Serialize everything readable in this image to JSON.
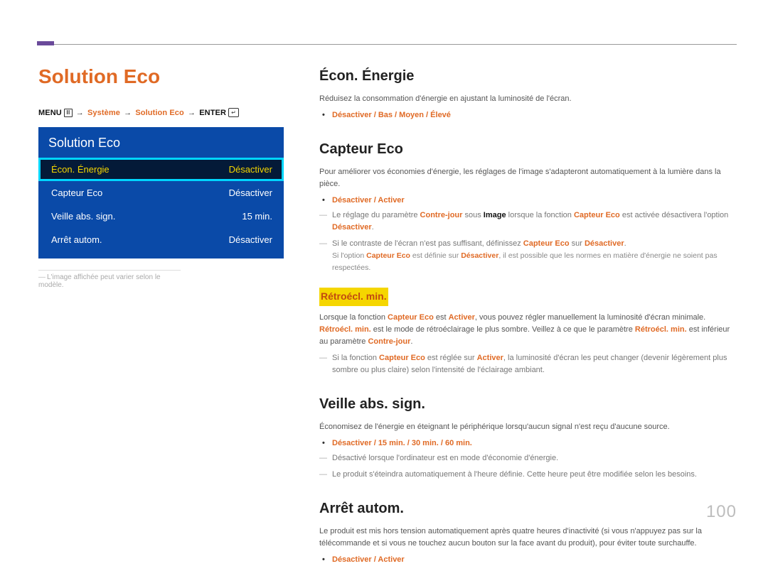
{
  "page_number": "100",
  "left": {
    "title": "Solution Eco",
    "breadcrumb": {
      "menu": "MENU",
      "sys": "Système",
      "eco": "Solution Eco",
      "enter": "ENTER"
    },
    "osd": {
      "title": "Solution Eco",
      "rows": [
        {
          "label": "Écon. Énergie",
          "value": "Désactiver",
          "selected": true
        },
        {
          "label": "Capteur Eco",
          "value": "Désactiver",
          "selected": false
        },
        {
          "label": "Veille abs. sign.",
          "value": "15 min.",
          "selected": false
        },
        {
          "label": "Arrêt autom.",
          "value": "Désactiver",
          "selected": false
        }
      ]
    },
    "footnote": "L'image affichée peut varier selon le modèle."
  },
  "right": {
    "econ": {
      "title": "Écon. Énergie",
      "desc": "Réduisez la consommation d'énergie en ajustant la luminosité de l'écran.",
      "options": "Désactiver / Bas / Moyen / Élevé"
    },
    "capteur": {
      "title": "Capteur Eco",
      "desc": "Pour améliorer vos économies d'énergie, les réglages de l'image s'adapteront automatiquement à la lumière dans la pièce.",
      "options": "Désactiver / Activer",
      "note1a": "Le réglage du paramètre ",
      "note1b": "Contre-jour",
      "note1c": " sous ",
      "note1d": "Image",
      "note1e": " lorsque la fonction ",
      "note1f": "Capteur Eco",
      "note1g": " est activée désactivera l'option ",
      "note1h": "Désactiver",
      "note1i": ".",
      "note2a": "Si le contraste de l'écran n'est pas suffisant, définissez ",
      "note2b": "Capteur Eco",
      "note2c": " sur ",
      "note2d": "Désactiver",
      "note2e": ".",
      "note2sub_a": "Si l'option ",
      "note2sub_b": "Capteur Eco",
      "note2sub_c": " est définie sur ",
      "note2sub_d": "Désactiver",
      "note2sub_e": ", il est possible que les normes en matière d'énergie ne soient pas respectées.",
      "retro_title": "Rétroécl. min.",
      "retro_p1a": "Lorsque la fonction ",
      "retro_p1b": "Capteur Eco",
      "retro_p1c": " est ",
      "retro_p1d": "Activer",
      "retro_p1e": ", vous pouvez régler manuellement la luminosité d'écran minimale. ",
      "retro_p1f": "Rétroécl. min.",
      "retro_p1g": " est le mode de rétroéclairage le plus sombre. Veillez à ce que le paramètre ",
      "retro_p1h": "Rétroécl. min.",
      "retro_p1i": " est inférieur au paramètre ",
      "retro_p1j": "Contre-jour",
      "retro_p1k": ".",
      "retro_note_a": "Si la fonction ",
      "retro_note_b": "Capteur Eco",
      "retro_note_c": " est réglée sur ",
      "retro_note_d": "Activer",
      "retro_note_e": ", la luminosité d'écran les peut changer (devenir légèrement plus sombre ou plus claire) selon l'intensité de l'éclairage ambiant."
    },
    "veille": {
      "title": "Veille abs. sign.",
      "desc": "Économisez de l'énergie en éteignant le périphérique lorsqu'aucun signal n'est reçu d'aucune source.",
      "options": "Désactiver / 15 min. / 30 min. / 60 min.",
      "note1": "Désactivé lorsque l'ordinateur est en mode d'économie d'énergie.",
      "note2": "Le produit s'éteindra automatiquement à l'heure définie. Cette heure peut être modifiée selon les besoins."
    },
    "arret": {
      "title": "Arrêt autom.",
      "desc": "Le produit est mis hors tension automatiquement après quatre heures d'inactivité (si vous n'appuyez pas sur la télécommande et si vous ne touchez aucun bouton sur la face avant du produit), pour éviter toute surchauffe.",
      "options": "Désactiver / Activer"
    }
  }
}
